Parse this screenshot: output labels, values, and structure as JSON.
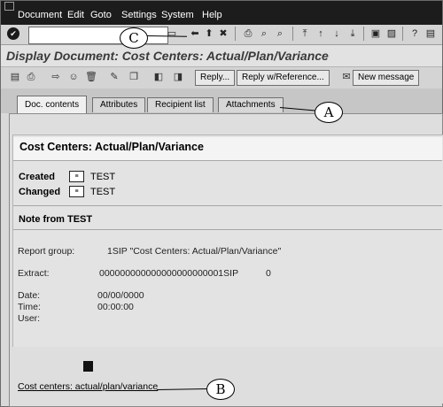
{
  "menu": {
    "items": [
      "Document",
      "Edit",
      "Goto",
      "Settings",
      "System",
      "Help"
    ]
  },
  "toolbar": {
    "enter_icon": "check-icon",
    "command_value": ""
  },
  "title": "Display Document: Cost Centers: Actual/Plan/Variance",
  "app_toolbar": {
    "buttons": [
      "Reply...",
      "Reply w/Reference...",
      "New message"
    ]
  },
  "tabs": [
    "Doc. contents",
    "Attributes",
    "Recipient list",
    "Attachments"
  ],
  "doc": {
    "heading": "Cost Centers: Actual/Plan/Variance",
    "created_label": "Created",
    "created_value": "TEST",
    "changed_label": "Changed",
    "changed_value": "TEST",
    "note_label": "Note from TEST",
    "report_group_label": "Report group:",
    "report_group_value": "1SIP \"Cost Centers: Actual/Plan/Variance\"",
    "extract_label": "Extract:",
    "extract_value": "000000000000000000000001SIP",
    "extract_count": "0",
    "date_label": "Date:",
    "date_value": "00/00/0000",
    "time_label": "Time:",
    "time_value": "00:00:00",
    "user_label": "User:",
    "user_value": ""
  },
  "link": {
    "label": "Cost centers: actual/plan/variance"
  },
  "callouts": {
    "a": "A",
    "b": "B",
    "c": "C"
  }
}
